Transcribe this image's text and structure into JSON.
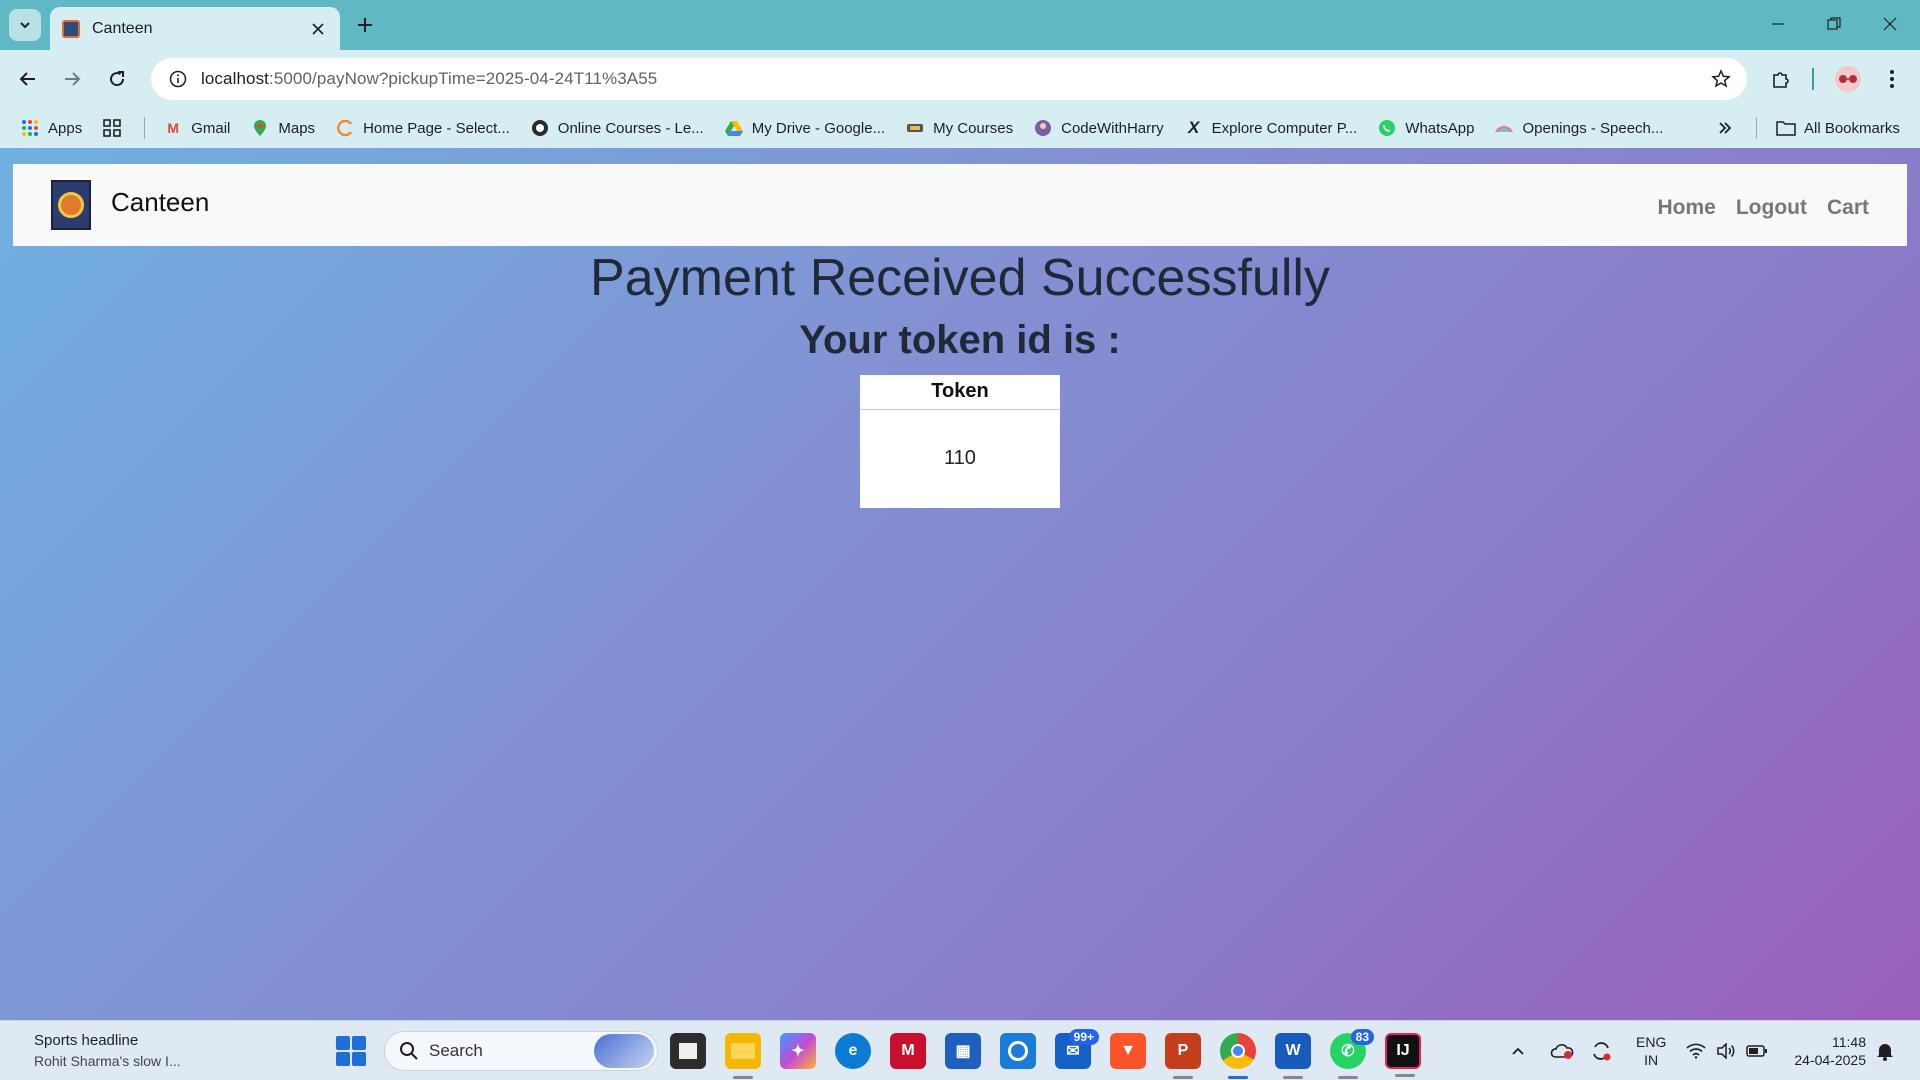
{
  "browser": {
    "tab_title": "Canteen",
    "url_host": "localhost",
    "url_path": ":5000/payNow?pickupTime=2025-04-24T11%3A55",
    "bookmarks": [
      {
        "label": "Apps",
        "icon": "apps-grid-icon"
      },
      {
        "label": "Gmail",
        "icon": "gmail-icon"
      },
      {
        "label": "Maps",
        "icon": "maps-icon"
      },
      {
        "label": "Home Page - Select...",
        "icon": "home-page-icon"
      },
      {
        "label": "Online Courses - Le...",
        "icon": "online-courses-icon"
      },
      {
        "label": "My Drive - Google...",
        "icon": "google-drive-icon"
      },
      {
        "label": "My Courses",
        "icon": "courses-icon"
      },
      {
        "label": "CodeWithHarry",
        "icon": "codewithharry-icon"
      },
      {
        "label": "Explore Computer P...",
        "icon": "explore-icon"
      },
      {
        "label": "WhatsApp",
        "icon": "whatsapp-icon"
      },
      {
        "label": "Openings - Speech...",
        "icon": "openings-icon"
      }
    ],
    "all_bookmarks_label": "All Bookmarks"
  },
  "page": {
    "brand": "Canteen",
    "nav_links": [
      "Home",
      "Logout",
      "Cart"
    ],
    "heading": "Payment Received Successfully",
    "subheading": "Your token id is :",
    "table_header": "Token",
    "token_value": "110"
  },
  "taskbar": {
    "news_title": "Sports headline",
    "news_sub": "Rohit Sharma's slow I...",
    "search_label": "Search",
    "mail_badge": "99+",
    "whatsapp_badge": "83",
    "lang_line1": "ENG",
    "lang_line2": "IN",
    "time": "11:48",
    "date": "24-04-2025"
  },
  "colors": {
    "tab_bg": "#5fb8c4",
    "toolbar_bg": "#d6eef2",
    "gradient_start": "#6fb0e0",
    "gradient_end": "#9a5fbc",
    "nav_link": "#777777"
  }
}
